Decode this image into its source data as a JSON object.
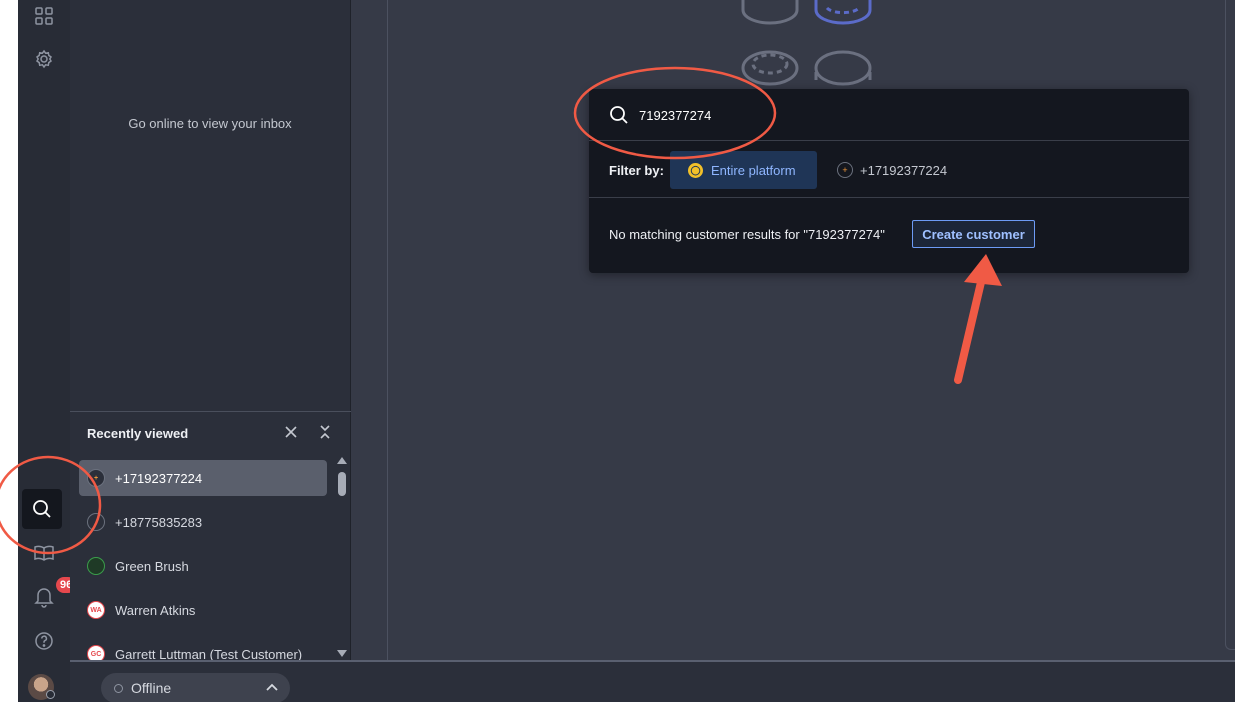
{
  "rail": {
    "icons": [
      "apps-grid-icon",
      "settings-gear-icon",
      "search-icon",
      "knowledge-book-icon",
      "notifications-bell-icon",
      "help-icon"
    ],
    "notification_count": "96"
  },
  "inbox": {
    "offline_message": "Go online to view your inbox"
  },
  "recently_viewed": {
    "title": "Recently viewed",
    "items": [
      {
        "label": "+17192377224",
        "icon_text": "+",
        "icon_color": "#f29a3a"
      },
      {
        "label": "+18775835283",
        "icon_text": "",
        "icon_color": "#6b717e"
      },
      {
        "label": "Green Brush",
        "icon_text": "",
        "icon_color": "#3a9d4a"
      },
      {
        "label": "Warren Atkins",
        "icon_text": "WA",
        "icon_color": "#e5484d"
      },
      {
        "label": "Garrett Luttman (Test Customer)",
        "icon_text": "GC",
        "icon_color": "#e5484d"
      }
    ]
  },
  "search": {
    "query": "7192377274",
    "filter_label": "Filter by:",
    "filter_platform": "Entire platform",
    "filter_phone": "+17192377224",
    "no_results": "No matching customer results for \"7192377274\"",
    "create_button": "Create customer"
  },
  "status": {
    "label": "Offline"
  },
  "colors": {
    "accent_blue": "#6d9bf5",
    "annotation_red": "#f05a45",
    "badge_red": "#e5484d"
  }
}
